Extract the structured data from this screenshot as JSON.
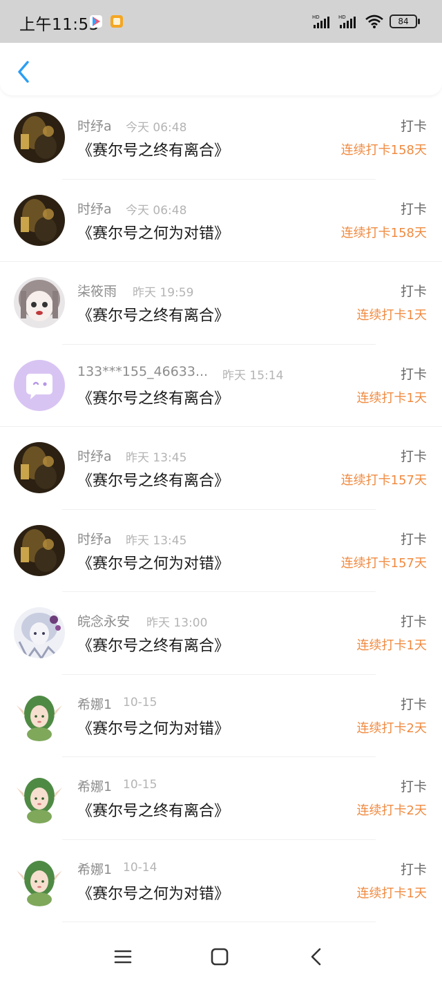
{
  "status_bar": {
    "time": "上午11:53",
    "battery": "84",
    "signal_label": "HD"
  },
  "header": {
    "back_icon": "chevron-left-icon"
  },
  "accent_color": "#f08a40",
  "entries": [
    {
      "name": "时纾a",
      "time": "今天 06:48",
      "title": "《赛尔号之终有离合》",
      "action": "打卡",
      "streak": "连续打卡158天",
      "avatar": "dark-photo"
    },
    {
      "name": "时纾a",
      "time": "今天 06:48",
      "title": "《赛尔号之何为对错》",
      "action": "打卡",
      "streak": "连续打卡158天",
      "avatar": "dark-photo"
    },
    {
      "name": "柒筱雨",
      "time": "昨天 19:59",
      "title": "《赛尔号之终有离合》",
      "action": "打卡",
      "streak": "连续打卡1天",
      "avatar": "anime-girl"
    },
    {
      "name": "133***155_46633...",
      "time": "昨天 15:14",
      "title": "《赛尔号之终有离合》",
      "action": "打卡",
      "streak": "连续打卡1天",
      "avatar": "default-chat"
    },
    {
      "name": "时纾a",
      "time": "昨天 13:45",
      "title": "《赛尔号之终有离合》",
      "action": "打卡",
      "streak": "连续打卡157天",
      "avatar": "dark-photo"
    },
    {
      "name": "时纾a",
      "time": "昨天 13:45",
      "title": "《赛尔号之何为对错》",
      "action": "打卡",
      "streak": "连续打卡157天",
      "avatar": "dark-photo"
    },
    {
      "name": "皖念永安",
      "time": "昨天 13:00",
      "title": "《赛尔号之终有离合》",
      "action": "打卡",
      "streak": "连续打卡1天",
      "avatar": "white-hair"
    },
    {
      "name": "希娜1",
      "time": "10-15",
      "title": "《赛尔号之何为对错》",
      "action": "打卡",
      "streak": "连续打卡2天",
      "avatar": "green-elf"
    },
    {
      "name": "希娜1",
      "time": "10-15",
      "title": "《赛尔号之终有离合》",
      "action": "打卡",
      "streak": "连续打卡2天",
      "avatar": "green-elf"
    },
    {
      "name": "希娜1",
      "time": "10-14",
      "title": "《赛尔号之何为对错》",
      "action": "打卡",
      "streak": "连续打卡1天",
      "avatar": "green-elf"
    }
  ],
  "nav_bar": {
    "menu_icon": "menu-icon",
    "home_icon": "home-icon",
    "back_icon": "back-icon"
  }
}
